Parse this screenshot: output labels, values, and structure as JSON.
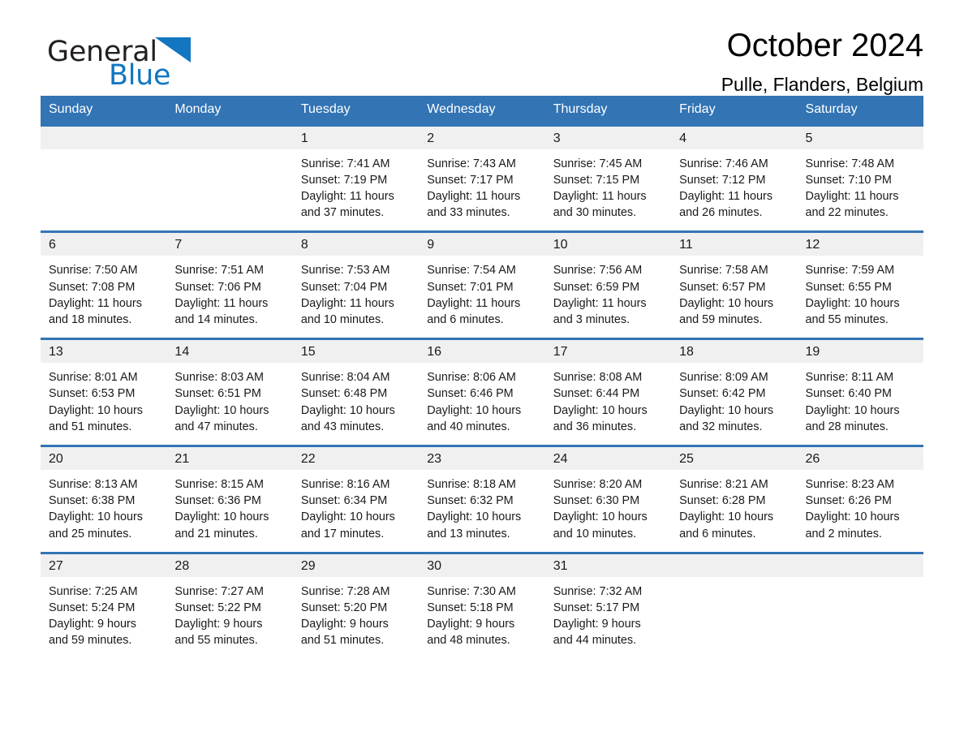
{
  "brand": {
    "name_part1": "General",
    "name_part2": "Blue",
    "triangle_color": "#1277c0"
  },
  "header": {
    "title": "October 2024",
    "location": "Pulle, Flanders, Belgium"
  },
  "theme": {
    "header_blue": "#3274b4",
    "daynum_band": "#f0f0f0",
    "text": "#1a1a1a",
    "page_background": "#ffffff"
  },
  "weekday_headers": [
    "Sunday",
    "Monday",
    "Tuesday",
    "Wednesday",
    "Thursday",
    "Friday",
    "Saturday"
  ],
  "weeks": [
    [
      {
        "day": "",
        "sunrise": "",
        "sunset": "",
        "daylight_line1": "",
        "daylight_line2": ""
      },
      {
        "day": "",
        "sunrise": "",
        "sunset": "",
        "daylight_line1": "",
        "daylight_line2": ""
      },
      {
        "day": "1",
        "sunrise": "Sunrise: 7:41 AM",
        "sunset": "Sunset: 7:19 PM",
        "daylight_line1": "Daylight: 11 hours",
        "daylight_line2": "and 37 minutes."
      },
      {
        "day": "2",
        "sunrise": "Sunrise: 7:43 AM",
        "sunset": "Sunset: 7:17 PM",
        "daylight_line1": "Daylight: 11 hours",
        "daylight_line2": "and 33 minutes."
      },
      {
        "day": "3",
        "sunrise": "Sunrise: 7:45 AM",
        "sunset": "Sunset: 7:15 PM",
        "daylight_line1": "Daylight: 11 hours",
        "daylight_line2": "and 30 minutes."
      },
      {
        "day": "4",
        "sunrise": "Sunrise: 7:46 AM",
        "sunset": "Sunset: 7:12 PM",
        "daylight_line1": "Daylight: 11 hours",
        "daylight_line2": "and 26 minutes."
      },
      {
        "day": "5",
        "sunrise": "Sunrise: 7:48 AM",
        "sunset": "Sunset: 7:10 PM",
        "daylight_line1": "Daylight: 11 hours",
        "daylight_line2": "and 22 minutes."
      }
    ],
    [
      {
        "day": "6",
        "sunrise": "Sunrise: 7:50 AM",
        "sunset": "Sunset: 7:08 PM",
        "daylight_line1": "Daylight: 11 hours",
        "daylight_line2": "and 18 minutes."
      },
      {
        "day": "7",
        "sunrise": "Sunrise: 7:51 AM",
        "sunset": "Sunset: 7:06 PM",
        "daylight_line1": "Daylight: 11 hours",
        "daylight_line2": "and 14 minutes."
      },
      {
        "day": "8",
        "sunrise": "Sunrise: 7:53 AM",
        "sunset": "Sunset: 7:04 PM",
        "daylight_line1": "Daylight: 11 hours",
        "daylight_line2": "and 10 minutes."
      },
      {
        "day": "9",
        "sunrise": "Sunrise: 7:54 AM",
        "sunset": "Sunset: 7:01 PM",
        "daylight_line1": "Daylight: 11 hours",
        "daylight_line2": "and 6 minutes."
      },
      {
        "day": "10",
        "sunrise": "Sunrise: 7:56 AM",
        "sunset": "Sunset: 6:59 PM",
        "daylight_line1": "Daylight: 11 hours",
        "daylight_line2": "and 3 minutes."
      },
      {
        "day": "11",
        "sunrise": "Sunrise: 7:58 AM",
        "sunset": "Sunset: 6:57 PM",
        "daylight_line1": "Daylight: 10 hours",
        "daylight_line2": "and 59 minutes."
      },
      {
        "day": "12",
        "sunrise": "Sunrise: 7:59 AM",
        "sunset": "Sunset: 6:55 PM",
        "daylight_line1": "Daylight: 10 hours",
        "daylight_line2": "and 55 minutes."
      }
    ],
    [
      {
        "day": "13",
        "sunrise": "Sunrise: 8:01 AM",
        "sunset": "Sunset: 6:53 PM",
        "daylight_line1": "Daylight: 10 hours",
        "daylight_line2": "and 51 minutes."
      },
      {
        "day": "14",
        "sunrise": "Sunrise: 8:03 AM",
        "sunset": "Sunset: 6:51 PM",
        "daylight_line1": "Daylight: 10 hours",
        "daylight_line2": "and 47 minutes."
      },
      {
        "day": "15",
        "sunrise": "Sunrise: 8:04 AM",
        "sunset": "Sunset: 6:48 PM",
        "daylight_line1": "Daylight: 10 hours",
        "daylight_line2": "and 43 minutes."
      },
      {
        "day": "16",
        "sunrise": "Sunrise: 8:06 AM",
        "sunset": "Sunset: 6:46 PM",
        "daylight_line1": "Daylight: 10 hours",
        "daylight_line2": "and 40 minutes."
      },
      {
        "day": "17",
        "sunrise": "Sunrise: 8:08 AM",
        "sunset": "Sunset: 6:44 PM",
        "daylight_line1": "Daylight: 10 hours",
        "daylight_line2": "and 36 minutes."
      },
      {
        "day": "18",
        "sunrise": "Sunrise: 8:09 AM",
        "sunset": "Sunset: 6:42 PM",
        "daylight_line1": "Daylight: 10 hours",
        "daylight_line2": "and 32 minutes."
      },
      {
        "day": "19",
        "sunrise": "Sunrise: 8:11 AM",
        "sunset": "Sunset: 6:40 PM",
        "daylight_line1": "Daylight: 10 hours",
        "daylight_line2": "and 28 minutes."
      }
    ],
    [
      {
        "day": "20",
        "sunrise": "Sunrise: 8:13 AM",
        "sunset": "Sunset: 6:38 PM",
        "daylight_line1": "Daylight: 10 hours",
        "daylight_line2": "and 25 minutes."
      },
      {
        "day": "21",
        "sunrise": "Sunrise: 8:15 AM",
        "sunset": "Sunset: 6:36 PM",
        "daylight_line1": "Daylight: 10 hours",
        "daylight_line2": "and 21 minutes."
      },
      {
        "day": "22",
        "sunrise": "Sunrise: 8:16 AM",
        "sunset": "Sunset: 6:34 PM",
        "daylight_line1": "Daylight: 10 hours",
        "daylight_line2": "and 17 minutes."
      },
      {
        "day": "23",
        "sunrise": "Sunrise: 8:18 AM",
        "sunset": "Sunset: 6:32 PM",
        "daylight_line1": "Daylight: 10 hours",
        "daylight_line2": "and 13 minutes."
      },
      {
        "day": "24",
        "sunrise": "Sunrise: 8:20 AM",
        "sunset": "Sunset: 6:30 PM",
        "daylight_line1": "Daylight: 10 hours",
        "daylight_line2": "and 10 minutes."
      },
      {
        "day": "25",
        "sunrise": "Sunrise: 8:21 AM",
        "sunset": "Sunset: 6:28 PM",
        "daylight_line1": "Daylight: 10 hours",
        "daylight_line2": "and 6 minutes."
      },
      {
        "day": "26",
        "sunrise": "Sunrise: 8:23 AM",
        "sunset": "Sunset: 6:26 PM",
        "daylight_line1": "Daylight: 10 hours",
        "daylight_line2": "and 2 minutes."
      }
    ],
    [
      {
        "day": "27",
        "sunrise": "Sunrise: 7:25 AM",
        "sunset": "Sunset: 5:24 PM",
        "daylight_line1": "Daylight: 9 hours",
        "daylight_line2": "and 59 minutes."
      },
      {
        "day": "28",
        "sunrise": "Sunrise: 7:27 AM",
        "sunset": "Sunset: 5:22 PM",
        "daylight_line1": "Daylight: 9 hours",
        "daylight_line2": "and 55 minutes."
      },
      {
        "day": "29",
        "sunrise": "Sunrise: 7:28 AM",
        "sunset": "Sunset: 5:20 PM",
        "daylight_line1": "Daylight: 9 hours",
        "daylight_line2": "and 51 minutes."
      },
      {
        "day": "30",
        "sunrise": "Sunrise: 7:30 AM",
        "sunset": "Sunset: 5:18 PM",
        "daylight_line1": "Daylight: 9 hours",
        "daylight_line2": "and 48 minutes."
      },
      {
        "day": "31",
        "sunrise": "Sunrise: 7:32 AM",
        "sunset": "Sunset: 5:17 PM",
        "daylight_line1": "Daylight: 9 hours",
        "daylight_line2": "and 44 minutes."
      },
      {
        "day": "",
        "sunrise": "",
        "sunset": "",
        "daylight_line1": "",
        "daylight_line2": ""
      },
      {
        "day": "",
        "sunrise": "",
        "sunset": "",
        "daylight_line1": "",
        "daylight_line2": ""
      }
    ]
  ]
}
